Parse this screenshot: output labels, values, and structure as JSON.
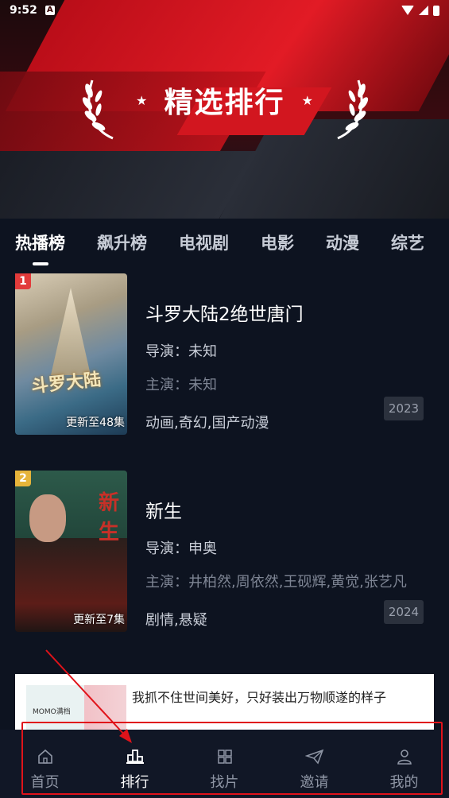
{
  "status_bar": {
    "time": "9:52",
    "app_badge": "A"
  },
  "banner": {
    "title": "精选排行"
  },
  "tabs": [
    {
      "label": "热播榜",
      "active": true
    },
    {
      "label": "飙升榜",
      "active": false
    },
    {
      "label": "电视剧",
      "active": false
    },
    {
      "label": "电影",
      "active": false
    },
    {
      "label": "动漫",
      "active": false
    },
    {
      "label": "综艺",
      "active": false
    }
  ],
  "items": [
    {
      "rank": "1",
      "poster_text": "斗罗大陆",
      "update": "更新至48集",
      "title": "斗罗大陆2绝世唐门",
      "director": "导演：未知",
      "cast": "主演：未知",
      "genre": "动画,奇幻,国产动漫",
      "year": "2023"
    },
    {
      "rank": "2",
      "poster_text": "新生",
      "update": "更新至7集",
      "title": "新生",
      "director": "导演：申奥",
      "cast": "主演：井柏然,周依然,王砚辉,黄觉,张艺凡",
      "genre": "剧情,悬疑",
      "year": "2024"
    }
  ],
  "ad": {
    "text": "我抓不住世间美好，只好装出万物顺遂的样子",
    "thumb_label": "MOMO满档"
  },
  "nav": [
    {
      "label": "首页",
      "icon": "home-icon",
      "active": false
    },
    {
      "label": "排行",
      "icon": "ranking-icon",
      "active": true
    },
    {
      "label": "找片",
      "icon": "grid-icon",
      "active": false
    },
    {
      "label": "邀请",
      "icon": "send-icon",
      "active": false
    },
    {
      "label": "我的",
      "icon": "user-icon",
      "active": false
    }
  ],
  "colors": {
    "accent_red": "#e21b25",
    "background": "#0d1320",
    "nav_background": "#111726",
    "annotation": "#e0131a"
  }
}
